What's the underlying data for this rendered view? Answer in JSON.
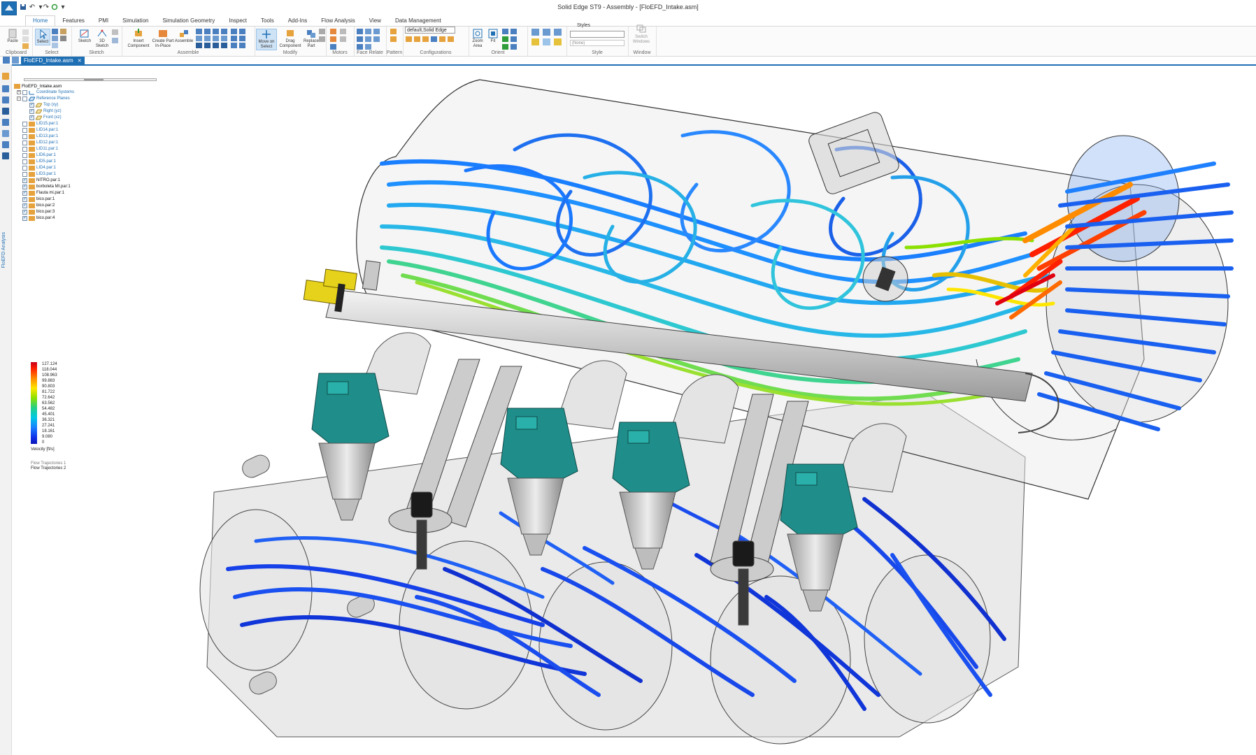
{
  "window": {
    "title": "Solid Edge ST9 - Assembly - [FloEFD_Intake.asm]"
  },
  "ribbon": {
    "tabs": [
      "Home",
      "Features",
      "PMI",
      "Simulation",
      "Simulation Geometry",
      "Inspect",
      "Tools",
      "Add-Ins",
      "Flow Analysis",
      "View",
      "Data Management"
    ],
    "groups": {
      "clipboard": "Clipboard",
      "select": "Select",
      "sketch": "Sketch",
      "assemble": "Assemble",
      "modify": "Modify",
      "motors": "Motors",
      "face_relate": "Face Relate",
      "pattern": "Pattern",
      "configurations": "Configurations",
      "orient": "Orient",
      "style": "Style",
      "window": "Window"
    },
    "buttons": {
      "paste": "Paste",
      "select": "Select",
      "sketch": "Sketch",
      "sketch_3d": "3D Sketch",
      "insert_component": "Insert Component",
      "create_part_in_place": "Create Part In-Place",
      "assemble": "Assemble",
      "move_on_select": "Move on Select",
      "drag_component": "Drag Component",
      "replace_part": "Replace Part",
      "zoom_area": "Zoom Area",
      "fit": "Fit",
      "switch_windows": "Switch Windows"
    },
    "configuration_value": "default,Solid Edge",
    "styles_label": "Styles",
    "style_value": "(None)"
  },
  "document_tab": {
    "label": "FloEFD_Intake.asm"
  },
  "side_strip": {
    "label": "FloEFD Analysis"
  },
  "pathfinder": {
    "items": [
      {
        "label": "FloEFD_Intake.asm"
      },
      {
        "label": "Coordinate Systems"
      },
      {
        "label": "Reference Planes"
      },
      {
        "label": "Top (xy)"
      },
      {
        "label": "Right (yz)"
      },
      {
        "label": "Front (xz)"
      },
      {
        "label": "LID15.par:1"
      },
      {
        "label": "LID14.par:1"
      },
      {
        "label": "LID13.par:1"
      },
      {
        "label": "LID12.par:1"
      },
      {
        "label": "LID11.par:1"
      },
      {
        "label": "LID6.par:1"
      },
      {
        "label": "LID5.par:1"
      },
      {
        "label": "LID4.par:1"
      },
      {
        "label": "LID3.par:1"
      },
      {
        "label": "NITRO.par:1"
      },
      {
        "label": "borboleta MI.par:1"
      },
      {
        "label": "Flauta mi.par:1"
      },
      {
        "label": "bico.par:1"
      },
      {
        "label": "bico.par:2"
      },
      {
        "label": "bico.par:3"
      },
      {
        "label": "bico.par:4"
      }
    ]
  },
  "legend": {
    "values": [
      "127.124",
      "118.044",
      "108.963",
      "99.883",
      "90.803",
      "81.722",
      "72.642",
      "63.562",
      "54.482",
      "45.401",
      "36.321",
      "27.241",
      "18.161",
      "9.080",
      "0"
    ],
    "title": "Velocity [ft/s]",
    "trajectories": [
      "Flow Trajectories 1",
      "Flow Trajectories 2"
    ]
  },
  "colors": {
    "accent": "#1f6fb5",
    "fuel_rail_fitting": "#e6d21a",
    "injector_body": "#1f8e8a"
  }
}
